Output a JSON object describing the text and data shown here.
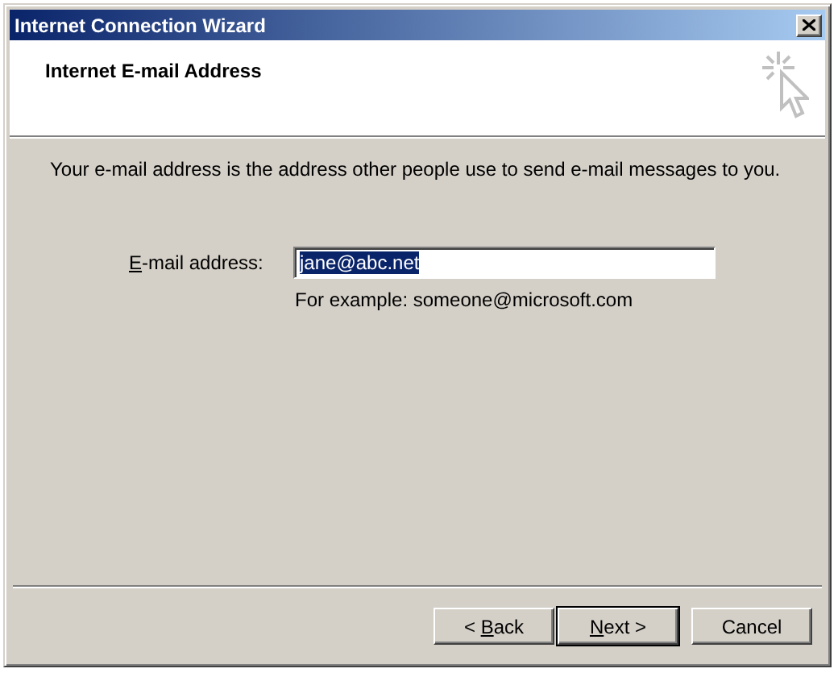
{
  "window": {
    "title": "Internet Connection Wizard"
  },
  "header": {
    "title": "Internet E-mail Address"
  },
  "description": "Your e-mail address is the address other people use to send e-mail messages to you.",
  "email_field": {
    "label": [
      {
        "text": "E",
        "underline": true
      },
      {
        "text": "-mail address:",
        "underline": false
      }
    ],
    "value": "jane@abc.net",
    "selected": true
  },
  "hint": "For example: someone@microsoft.com",
  "buttons": [
    {
      "label": [
        {
          "text": "< ",
          "underline": false
        },
        {
          "text": "B",
          "underline": true
        },
        {
          "text": "ack",
          "underline": false
        }
      ],
      "default": false
    },
    {
      "label": [
        {
          "text": "N",
          "underline": true
        },
        {
          "text": "ext >",
          "underline": false
        }
      ],
      "default": true
    },
    {
      "label": [
        {
          "text": "Cancel",
          "underline": false
        }
      ],
      "default": false
    }
  ]
}
